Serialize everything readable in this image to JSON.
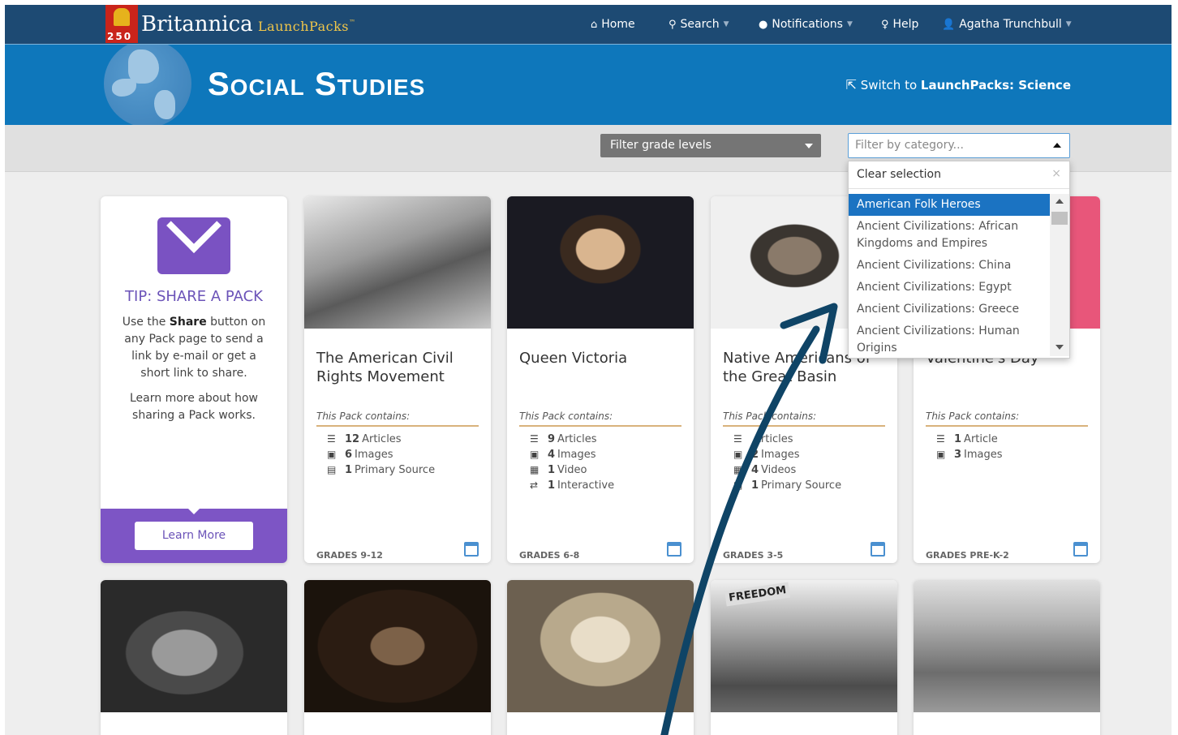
{
  "brand": {
    "badge_number": "250",
    "name": "Britannica",
    "product": "LaunchPacks"
  },
  "nav": {
    "home": "Home",
    "search": "Search",
    "notifications": "Notifications",
    "help": "Help",
    "user": "Agatha Trunchbull"
  },
  "hero": {
    "title": "Social Studies",
    "switch_prefix": "Switch to ",
    "switch_target": "LaunchPacks: Science"
  },
  "filters": {
    "grade_label": "Filter grade levels",
    "category_placeholder": "Filter by category..."
  },
  "dropdown": {
    "clear_label": "Clear selection",
    "clear_x": "×",
    "options": [
      {
        "label": "American Folk Heroes"
      },
      {
        "label": "Ancient Civilizations: African Kingdoms and Empires"
      },
      {
        "label": "Ancient Civilizations: China"
      },
      {
        "label": "Ancient Civilizations: Egypt"
      },
      {
        "label": "Ancient Civilizations: Greece"
      },
      {
        "label": "Ancient Civilizations: Human Origins"
      }
    ]
  },
  "tip": {
    "title": "TIP: SHARE A PACK",
    "body_pre": "Use the ",
    "body_bold": "Share",
    "body_post": " button on any Pack page to send a link by e-mail or get a short link to share.",
    "more": "Learn more about how sharing a Pack works.",
    "button": "Learn More"
  },
  "contains_label": "This Pack contains:",
  "cards": [
    {
      "title": "The American Civil Rights Movement",
      "items": [
        {
          "count": "12",
          "label": "Articles"
        },
        {
          "count": "6",
          "label": "Images"
        },
        {
          "count": "1",
          "label": "Primary Source"
        }
      ],
      "grades": "GRADES 9-12"
    },
    {
      "title": "Queen Victoria",
      "items": [
        {
          "count": "9",
          "label": "Articles"
        },
        {
          "count": "4",
          "label": "Images"
        },
        {
          "count": "1",
          "label": "Video"
        },
        {
          "count": "1",
          "label": "Interactive"
        }
      ],
      "grades": "GRADES 6-8"
    },
    {
      "title": "Native Americans of the Great Basin",
      "items": [
        {
          "count": "",
          "label": "Articles"
        },
        {
          "count": "2",
          "label": "Images"
        },
        {
          "count": "4",
          "label": "Videos"
        },
        {
          "count": "1",
          "label": "Primary Source"
        }
      ],
      "grades": "GRADES 3-5"
    },
    {
      "title": "Valentine's Day",
      "items": [
        {
          "count": "1",
          "label": "Article"
        },
        {
          "count": "3",
          "label": "Images"
        }
      ],
      "grades": "GRADES PRE-K-2"
    }
  ],
  "march_sign": "FREEDOM"
}
